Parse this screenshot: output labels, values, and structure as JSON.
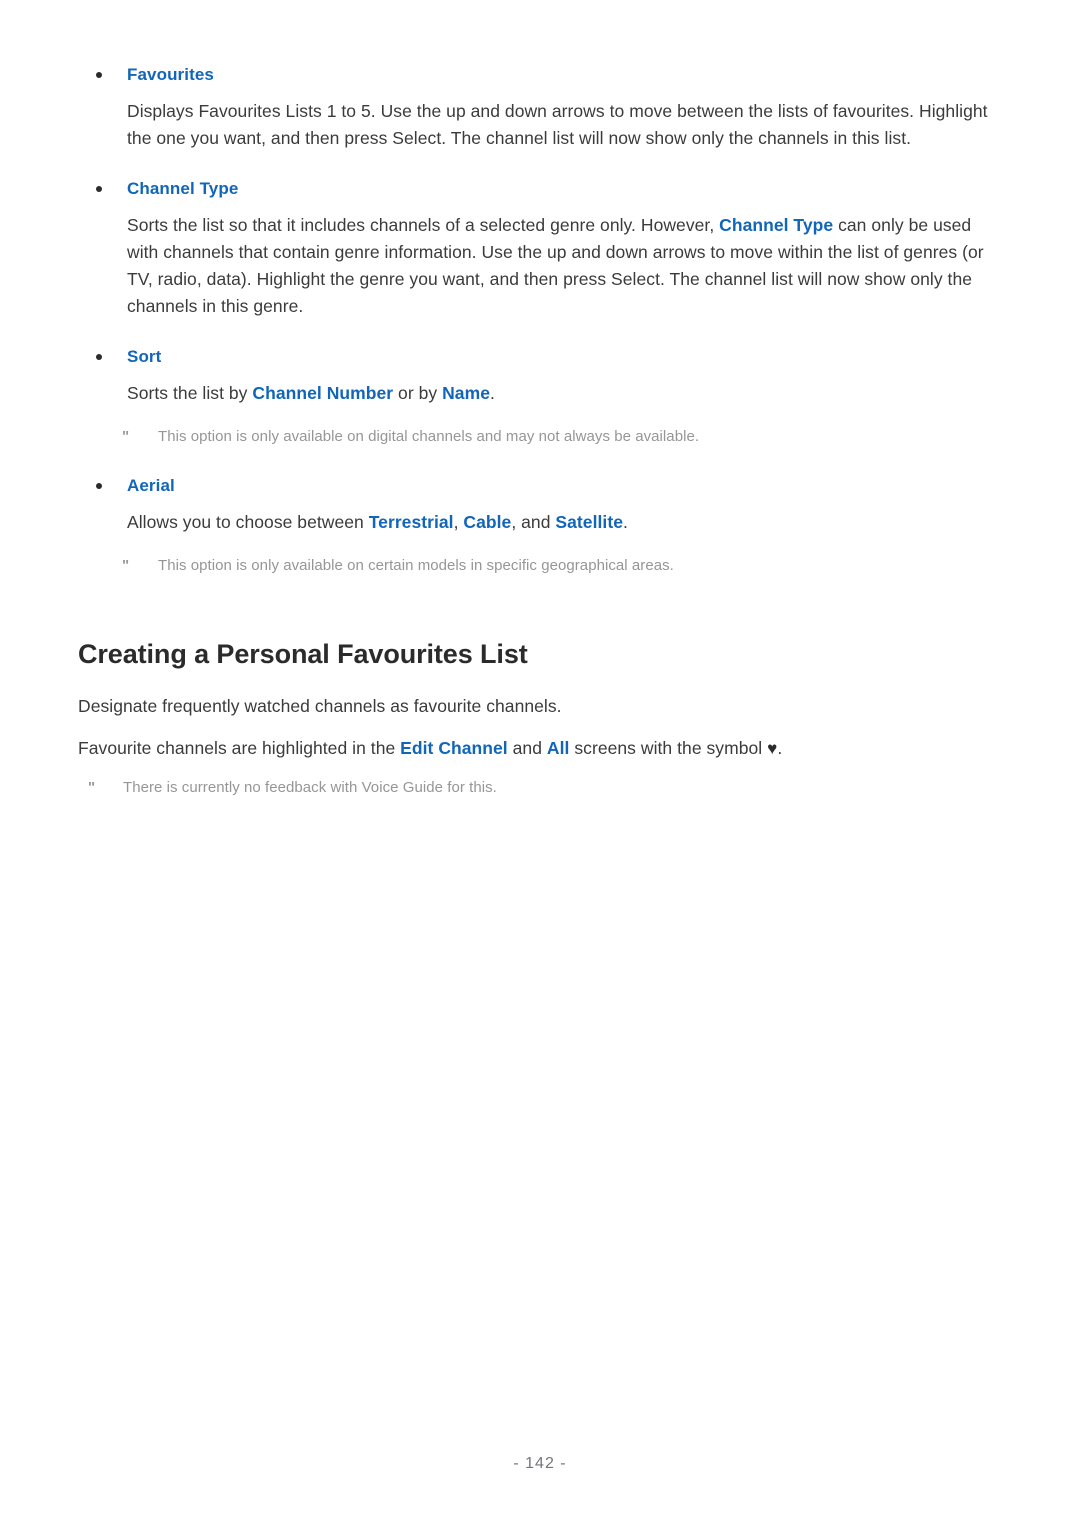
{
  "page": {
    "number_label": "- 142 -",
    "link_color": "#1266b8",
    "body_color": "#3b3b3b",
    "note_color": "#969696",
    "heading_color": "#2b2b2b",
    "background": "#ffffff"
  },
  "items": [
    {
      "label": "Favourites",
      "body_pre": "Displays Favourites Lists 1 to 5. Use the up and down arrows to move between the lists of favourites. Highlight the one you want, and then press Select. The channel list will now show only the channels in this list."
    },
    {
      "label": "Channel Type",
      "body_pre": "Sorts the list so that it includes channels of a selected genre only. However, ",
      "body_link": "Channel Type",
      "body_post": " can only be used with channels that contain genre information. Use the up and down arrows to move within the list of genres (or TV, radio, data). Highlight the genre you want, and then press Select. The channel list will now show only the channels in this genre."
    },
    {
      "label": "Sort",
      "body_pre": "Sorts the list by ",
      "body_link1": "Channel Number",
      "body_mid": " or by ",
      "body_link2": "Name",
      "body_post": ".",
      "note": "This option is only available on digital channels and may not always be available.",
      "note_mark": "\""
    },
    {
      "label": "Aerial",
      "body_pre": "Allows you to choose between ",
      "body_link1": "Terrestrial",
      "body_mid1": ", ",
      "body_link2": "Cable",
      "body_mid2": ", and ",
      "body_link3": "Satellite",
      "body_post": ".",
      "note": "This option is only available on certain models in specific geographical areas.",
      "note_mark": "\""
    }
  ],
  "section": {
    "heading": "Creating a Personal Favourites List",
    "para1": "Designate frequently watched channels as favourite channels.",
    "para2_pre": "Favourite channels are highlighted in the ",
    "para2_link1": "Edit Channel",
    "para2_mid": " and ",
    "para2_link2": "All",
    "para2_post": " screens with the symbol ",
    "para2_symbol": "♥",
    "para2_end": ".",
    "note": "There is currently no feedback with Voice Guide for this.",
    "note_mark": "\""
  }
}
